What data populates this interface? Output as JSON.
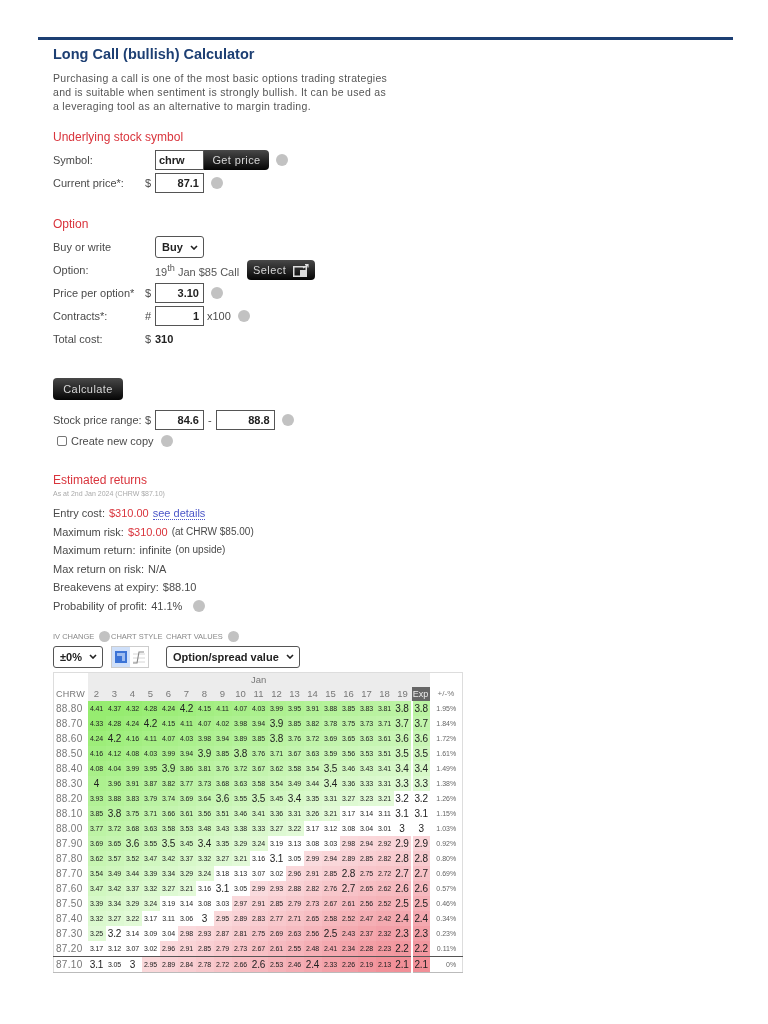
{
  "title": "Long Call (bullish) Calculator",
  "description": "Purchasing a call is one of the most basic options trading strategies and is suitable when sentiment is strongly bullish. It can be used as a leveraging tool as an alternative to margin trading.",
  "underlying": {
    "heading": "Underlying stock symbol",
    "symbol": {
      "label": "Symbol:",
      "value": "chrw",
      "button": "Get price",
      "help": true
    },
    "current_price": {
      "label": "Current price*:",
      "prefix": "$",
      "value": "87.1",
      "help": true
    }
  },
  "option": {
    "heading": "Option",
    "buy_or_write": {
      "label": "Buy or write",
      "value": "Buy"
    },
    "option": {
      "label": "Option:",
      "value": "19$^{th}$ Jan $85 Call",
      "button": "Select"
    },
    "price_per_option": {
      "label": "Price per option*",
      "prefix": "$",
      "value": "3.10",
      "help": true
    },
    "contracts": {
      "label": "Contracts*:",
      "prefix": "#",
      "value": "1",
      "suffix": "x100",
      "help": true
    },
    "total_cost": {
      "label": "Total cost:",
      "prefix": "$",
      "value": "310"
    }
  },
  "calculate_button": "Calculate",
  "range": {
    "label": "Stock price range:",
    "prefix": "$",
    "from": "84.6",
    "separator": "-",
    "to": "88.8",
    "help": true
  },
  "create_copy": {
    "label": "Create new copy",
    "checked": false,
    "help": true
  },
  "returns": {
    "heading": "Estimated returns",
    "as_at": "As at 2nd Jan 2024 (CHRW $87.10)",
    "metrics": [
      {
        "label": "Entry cost:",
        "value": "$310.00",
        "negative": true,
        "link": "see details",
        "help": false
      },
      {
        "label": "Maximum risk:",
        "value": "$310.00",
        "negative": true,
        "note": "(at CHRW $85.00)",
        "help": false
      },
      {
        "label": "Maximum return:",
        "value": "infinite",
        "negative": false,
        "note": "(on upside)",
        "help": false
      },
      {
        "label": "Max return on risk:",
        "value": "N/A",
        "negative": false,
        "help": false
      },
      {
        "label": "Breakevens at expiry:",
        "value": "$88.10",
        "negative": false,
        "help": false
      },
      {
        "label": "Probability of profit:",
        "value": "41.1%",
        "negative": false,
        "help": true
      }
    ]
  },
  "chart_controls": {
    "iv_change": {
      "label": "IV CHANGE",
      "value": "±0%",
      "help": true
    },
    "chart_style": {
      "label": "CHART STYLE",
      "options": [
        {
          "kind": "table",
          "selected": true
        },
        {
          "kind": "line",
          "selected": false
        }
      ]
    },
    "chart_values": {
      "label": "CHART VALUES",
      "value": "Option/spread value",
      "help": true
    }
  },
  "table": {
    "month": "Jan",
    "corner": "CHRW",
    "change_header": "+/-%",
    "columns": [
      {
        "label": "2",
        "selected": false
      },
      {
        "label": "3",
        "selected": false
      },
      {
        "label": "4",
        "selected": false
      },
      {
        "label": "5",
        "selected": false
      },
      {
        "label": "6",
        "selected": false
      },
      {
        "label": "7",
        "selected": false
      },
      {
        "label": "8",
        "selected": false
      },
      {
        "label": "9",
        "selected": false
      },
      {
        "label": "10",
        "selected": false
      },
      {
        "label": "11",
        "selected": false
      },
      {
        "label": "12",
        "selected": false
      },
      {
        "label": "13",
        "selected": false
      },
      {
        "label": "14",
        "selected": false
      },
      {
        "label": "15",
        "selected": false
      },
      {
        "label": "16",
        "selected": false
      },
      {
        "label": "17",
        "selected": false
      },
      {
        "label": "18",
        "selected": false
      },
      {
        "label": "19",
        "selected": false
      },
      {
        "label": "Exp",
        "selected": true
      }
    ],
    "rows": [
      {
        "price": "88.80",
        "current": false,
        "values": [
          "4.41",
          "4.37",
          "4.32",
          "4.28",
          "4.24",
          "4.2",
          "4.15",
          "4.11",
          "4.07",
          "4.03",
          "3.99",
          "3.95",
          "3.91",
          "3.88",
          "3.85",
          "3.83",
          "3.81",
          "3.8",
          "3.8"
        ],
        "change": "1.95%"
      },
      {
        "price": "88.70",
        "current": false,
        "values": [
          "4.33",
          "4.28",
          "4.24",
          "4.2",
          "4.15",
          "4.11",
          "4.07",
          "4.02",
          "3.98",
          "3.94",
          "3.9",
          "3.85",
          "3.82",
          "3.78",
          "3.75",
          "3.73",
          "3.71",
          "3.7",
          "3.7"
        ],
        "change": "1.84%"
      },
      {
        "price": "88.60",
        "current": false,
        "values": [
          "4.24",
          "4.2",
          "4.16",
          "4.11",
          "4.07",
          "4.03",
          "3.98",
          "3.94",
          "3.89",
          "3.85",
          "3.8",
          "3.76",
          "3.72",
          "3.69",
          "3.65",
          "3.63",
          "3.61",
          "3.6",
          "3.6"
        ],
        "change": "1.72%"
      },
      {
        "price": "88.50",
        "current": false,
        "values": [
          "4.16",
          "4.12",
          "4.08",
          "4.03",
          "3.99",
          "3.94",
          "3.9",
          "3.85",
          "3.8",
          "3.76",
          "3.71",
          "3.67",
          "3.63",
          "3.59",
          "3.56",
          "3.53",
          "3.51",
          "3.5",
          "3.5"
        ],
        "change": "1.61%"
      },
      {
        "price": "88.40",
        "current": false,
        "values": [
          "4.08",
          "4.04",
          "3.99",
          "3.95",
          "3.9",
          "3.86",
          "3.81",
          "3.76",
          "3.72",
          "3.67",
          "3.62",
          "3.58",
          "3.54",
          "3.5",
          "3.46",
          "3.43",
          "3.41",
          "3.4",
          "3.4"
        ],
        "change": "1.49%"
      },
      {
        "price": "88.30",
        "current": false,
        "values": [
          "4",
          "3.96",
          "3.91",
          "3.87",
          "3.82",
          "3.77",
          "3.73",
          "3.68",
          "3.63",
          "3.58",
          "3.54",
          "3.49",
          "3.44",
          "3.4",
          "3.36",
          "3.33",
          "3.31",
          "3.3",
          "3.3"
        ],
        "change": "1.38%"
      },
      {
        "price": "88.20",
        "current": false,
        "values": [
          "3.93",
          "3.88",
          "3.83",
          "3.79",
          "3.74",
          "3.69",
          "3.64",
          "3.6",
          "3.55",
          "3.5",
          "3.45",
          "3.4",
          "3.35",
          "3.31",
          "3.27",
          "3.23",
          "3.21",
          "3.2",
          "3.2"
        ],
        "change": "1.26%"
      },
      {
        "price": "88.10",
        "current": false,
        "values": [
          "3.85",
          "3.8",
          "3.75",
          "3.71",
          "3.66",
          "3.61",
          "3.56",
          "3.51",
          "3.46",
          "3.41",
          "3.36",
          "3.31",
          "3.26",
          "3.21",
          "3.17",
          "3.14",
          "3.11",
          "3.1",
          "3.1"
        ],
        "change": "1.15%"
      },
      {
        "price": "88.00",
        "current": false,
        "values": [
          "3.77",
          "3.72",
          "3.68",
          "3.63",
          "3.58",
          "3.53",
          "3.48",
          "3.43",
          "3.38",
          "3.33",
          "3.27",
          "3.22",
          "3.17",
          "3.12",
          "3.08",
          "3.04",
          "3.01",
          "3",
          "3"
        ],
        "change": "1.03%"
      },
      {
        "price": "87.90",
        "current": false,
        "values": [
          "3.69",
          "3.65",
          "3.6",
          "3.55",
          "3.5",
          "3.45",
          "3.4",
          "3.35",
          "3.29",
          "3.24",
          "3.19",
          "3.13",
          "3.08",
          "3.03",
          "2.98",
          "2.94",
          "2.92",
          "2.9",
          "2.9"
        ],
        "change": "0.92%"
      },
      {
        "price": "87.80",
        "current": false,
        "values": [
          "3.62",
          "3.57",
          "3.52",
          "3.47",
          "3.42",
          "3.37",
          "3.32",
          "3.27",
          "3.21",
          "3.16",
          "3.1",
          "3.05",
          "2.99",
          "2.94",
          "2.89",
          "2.85",
          "2.82",
          "2.8",
          "2.8"
        ],
        "change": "0.80%"
      },
      {
        "price": "87.70",
        "current": false,
        "values": [
          "3.54",
          "3.49",
          "3.44",
          "3.39",
          "3.34",
          "3.29",
          "3.24",
          "3.18",
          "3.13",
          "3.07",
          "3.02",
          "2.96",
          "2.91",
          "2.85",
          "2.8",
          "2.75",
          "2.72",
          "2.7",
          "2.7"
        ],
        "change": "0.69%"
      },
      {
        "price": "87.60",
        "current": false,
        "values": [
          "3.47",
          "3.42",
          "3.37",
          "3.32",
          "3.27",
          "3.21",
          "3.16",
          "3.1",
          "3.05",
          "2.99",
          "2.93",
          "2.88",
          "2.82",
          "2.76",
          "2.7",
          "2.65",
          "2.62",
          "2.6",
          "2.6"
        ],
        "change": "0.57%"
      },
      {
        "price": "87.50",
        "current": false,
        "values": [
          "3.39",
          "3.34",
          "3.29",
          "3.24",
          "3.19",
          "3.14",
          "3.08",
          "3.03",
          "2.97",
          "2.91",
          "2.85",
          "2.79",
          "2.73",
          "2.67",
          "2.61",
          "2.56",
          "2.52",
          "2.5",
          "2.5"
        ],
        "change": "0.46%"
      },
      {
        "price": "87.40",
        "current": false,
        "values": [
          "3.32",
          "3.27",
          "3.22",
          "3.17",
          "3.11",
          "3.06",
          "3",
          "2.95",
          "2.89",
          "2.83",
          "2.77",
          "2.71",
          "2.65",
          "2.58",
          "2.52",
          "2.47",
          "2.42",
          "2.4",
          "2.4"
        ],
        "change": "0.34%"
      },
      {
        "price": "87.30",
        "current": false,
        "values": [
          "3.25",
          "3.2",
          "3.14",
          "3.09",
          "3.04",
          "2.98",
          "2.93",
          "2.87",
          "2.81",
          "2.75",
          "2.69",
          "2.63",
          "2.56",
          "2.5",
          "2.43",
          "2.37",
          "2.32",
          "2.3",
          "2.3"
        ],
        "change": "0.23%"
      },
      {
        "price": "87.20",
        "current": false,
        "values": [
          "3.17",
          "3.12",
          "3.07",
          "3.02",
          "2.96",
          "2.91",
          "2.85",
          "2.79",
          "2.73",
          "2.67",
          "2.61",
          "2.55",
          "2.48",
          "2.41",
          "2.34",
          "2.28",
          "2.23",
          "2.2",
          "2.2"
        ],
        "change": "0.11%"
      },
      {
        "price": "87.10",
        "current": true,
        "values": [
          "3.1",
          "3.05",
          "3",
          "2.95",
          "2.89",
          "2.84",
          "2.78",
          "2.72",
          "2.66",
          "2.6",
          "2.53",
          "2.46",
          "2.4",
          "2.33",
          "2.26",
          "2.19",
          "2.13",
          "2.1",
          "2.1"
        ],
        "change": "0%"
      }
    ]
  }
}
